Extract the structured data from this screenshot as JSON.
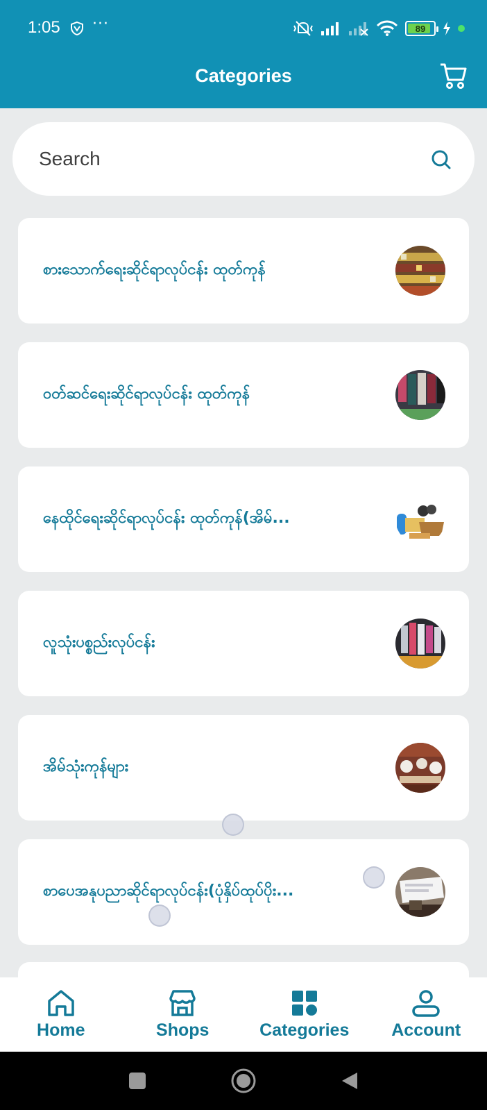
{
  "status_bar": {
    "time": "1:05",
    "dots": "···",
    "battery_level": 89,
    "battery_label": "89"
  },
  "header": {
    "title": "Categories"
  },
  "search": {
    "placeholder": "Search"
  },
  "categories": [
    {
      "label": "စားသောက်ရေးဆိုင်ရာလုပ်ငန်း ထုတ်ကုန်",
      "thumb_icon": "food-store-photo"
    },
    {
      "label": "ဝတ်ဆင်ရေးဆိုင်ရာလုပ်ငန်း ထုတ်ကုန်",
      "thumb_icon": "clothing-store-photo"
    },
    {
      "label": "နေထိုင်ရေးဆိုင်ရာလုပ်ငန်း ထုတ်ကုန်(အိမ်...",
      "thumb_icon": "building-materials-photo"
    },
    {
      "label": "လူသုံးပစ္စည်းလုပ်ငန်း",
      "thumb_icon": "consumer-goods-photo"
    },
    {
      "label": "အိမ်သုံးကုန်များ",
      "thumb_icon": "household-goods-photo"
    },
    {
      "label": "စာပေအနုပညာဆိုင်ရာလုပ်ငန်း(ပုံနှိပ်ထုပ်ပိုး...",
      "thumb_icon": "printing-photo"
    }
  ],
  "bottom_nav": {
    "home": "Home",
    "shops": "Shops",
    "categories": "Categories",
    "account": "Account",
    "accent_color": "#147a98"
  },
  "colors": {
    "header": "#1191b5",
    "background": "#e9ebec",
    "text_accent": "#147a98"
  }
}
